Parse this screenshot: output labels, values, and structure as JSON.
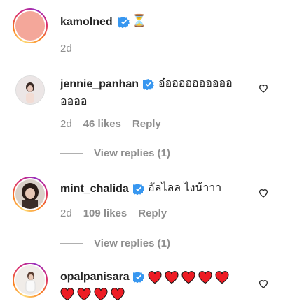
{
  "post": {
    "username": "kamolned",
    "emoji": "⏳",
    "time": "2d",
    "avatar_color": "#f4a79a"
  },
  "comments": [
    {
      "username": "jennie_panhan",
      "text_line1": "อ๋ออออออออออ",
      "text_line2": "ออออ",
      "time": "2d",
      "likes": "46 likes",
      "reply": "Reply",
      "view_replies": "View replies (1)"
    },
    {
      "username": "mint_chalida",
      "text_line1": "อัลไลล ไงน้าาา",
      "time": "2d",
      "likes": "109 likes",
      "reply": "Reply",
      "view_replies": "View replies (1)"
    },
    {
      "username": "opalpanisara",
      "hearts_line1": 5,
      "hearts_line2": 4
    }
  ],
  "colors": {
    "verified": "#3897f0",
    "heart_red": "#ed1c24",
    "muted": "#8e8e8e"
  }
}
